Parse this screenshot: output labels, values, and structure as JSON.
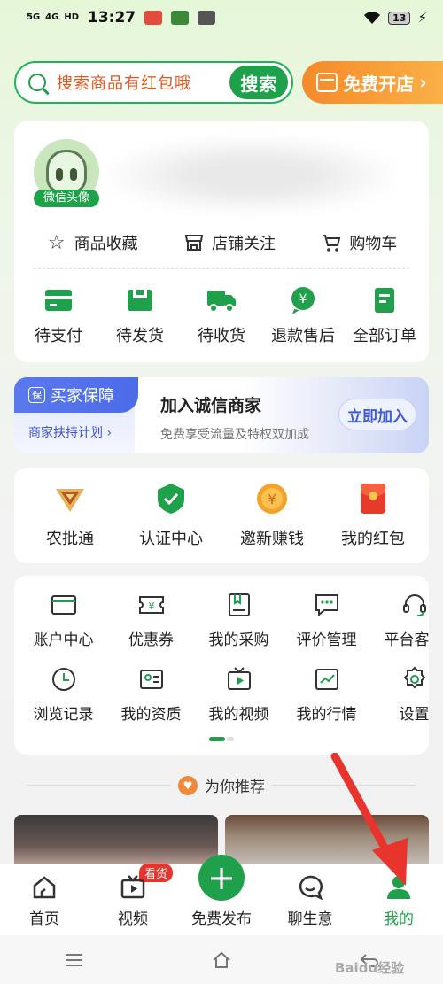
{
  "status_bar": {
    "signal1": "5G",
    "signal2": "4G",
    "hd": "HD",
    "time": "13:27",
    "battery": "13"
  },
  "search": {
    "placeholder": "搜索商品有红包哦",
    "button": "搜索"
  },
  "shop_button": "免费开店",
  "profile": {
    "avatar_badge": "微信头像",
    "quick_links": [
      "商品收藏",
      "店铺关注",
      "购物车"
    ],
    "orders": [
      "待支付",
      "待发货",
      "待收货",
      "退款售后",
      "全部订单"
    ]
  },
  "banner": {
    "tag": "买家保障",
    "tag_icon": "保",
    "sub": "商家扶持计划 ›",
    "title": "加入诚信商家",
    "desc": "免费享受流量及特权双加成",
    "button": "立即加入"
  },
  "services": [
    "农批通",
    "认证中心",
    "邀新赚钱",
    "我的红包"
  ],
  "tools": {
    "row1": [
      "账户中心",
      "优惠券",
      "我的采购",
      "评价管理",
      "平台客服"
    ],
    "row2": [
      "浏览记录",
      "我的资质",
      "我的视频",
      "我的行情",
      "设置"
    ]
  },
  "recommend": {
    "title": "为你推荐"
  },
  "tab_bar": {
    "items": [
      "首页",
      "视频",
      "免费发布",
      "聊生意",
      "我的"
    ],
    "video_badge": "看货",
    "active": "我的"
  },
  "watermark": "Baidu经验",
  "colors": {
    "brand_green": "#1fa04a",
    "accent_orange": "#e2571e",
    "annotation_red": "#e8342c"
  }
}
